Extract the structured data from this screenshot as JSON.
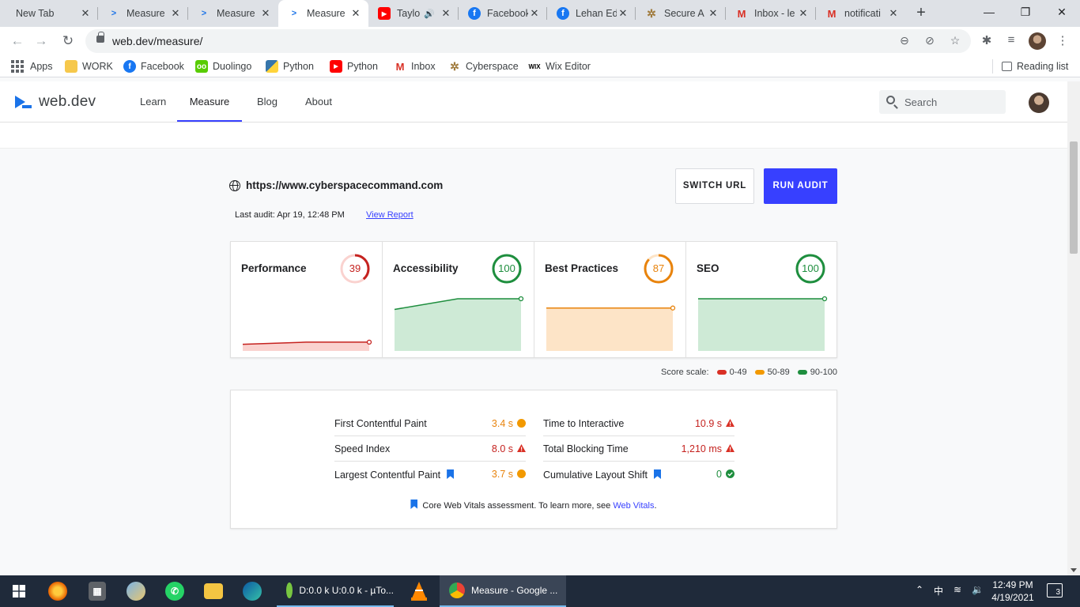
{
  "browser": {
    "tabs": [
      {
        "title": "New Tab",
        "icon": "none"
      },
      {
        "title": "Measure",
        "icon": "webdev-icon"
      },
      {
        "title": "Measure",
        "icon": "webdev-icon"
      },
      {
        "title": "Measure",
        "icon": "webdev-icon",
        "active": true
      },
      {
        "title": "Taylo",
        "icon": "youtube-icon",
        "audio": true
      },
      {
        "title": "Facebook",
        "icon": "facebook-icon"
      },
      {
        "title": "Lehan Ed",
        "icon": "facebook-icon"
      },
      {
        "title": "Secure A",
        "icon": "cyberspace-icon"
      },
      {
        "title": "Inbox - le",
        "icon": "gmail-icon"
      },
      {
        "title": "notificati",
        "icon": "gmail-icon"
      }
    ],
    "url": "web.dev/measure/",
    "bookmarks": [
      {
        "label": "Apps",
        "icon": "apps-grid-icon"
      },
      {
        "label": "WORK",
        "icon": "folder-icon"
      },
      {
        "label": "Facebook",
        "icon": "facebook-icon"
      },
      {
        "label": "Duolingo",
        "icon": "duolingo-icon"
      },
      {
        "label": "Python",
        "icon": "python-icon"
      },
      {
        "label": "Python",
        "icon": "youtube-icon"
      },
      {
        "label": "Inbox",
        "icon": "gmail-icon"
      },
      {
        "label": "Cyberspace",
        "icon": "cyberspace-icon"
      },
      {
        "label": "Wix Editor",
        "icon": "wix-icon"
      }
    ],
    "reading_list": "Reading list"
  },
  "site": {
    "logo": "web.dev",
    "nav": [
      "Learn",
      "Measure",
      "Blog",
      "About"
    ],
    "active_nav": "Measure",
    "search_placeholder": "Search"
  },
  "audit": {
    "url": "https://www.cyberspacecommand.com",
    "last_audit": "Last audit: Apr 19, 12:48 PM",
    "view_report": "View Report",
    "switch_url": "SWITCH URL",
    "run_audit": "RUN AUDIT"
  },
  "scores": [
    {
      "label": "Performance",
      "score": "39",
      "value": 39,
      "color": "#c5221f",
      "fill": "#fad2cf",
      "history": [
        36,
        39,
        39
      ]
    },
    {
      "label": "Accessibility",
      "score": "100",
      "value": 100,
      "color": "#1e8e3e",
      "fill": "#ceead6",
      "history": [
        85,
        100,
        100
      ]
    },
    {
      "label": "Best Practices",
      "score": "87",
      "value": 87,
      "color": "#e8830c",
      "fill": "#fde4c7",
      "history": [
        87,
        87,
        87
      ]
    },
    {
      "label": "SEO",
      "score": "100",
      "value": 100,
      "color": "#1e8e3e",
      "fill": "#ceead6",
      "history": [
        100,
        100,
        100
      ]
    }
  ],
  "score_scale": {
    "label": "Score scale:",
    "ranges": [
      {
        "label": "0-49",
        "color": "#d93025"
      },
      {
        "label": "50-89",
        "color": "#f29900"
      },
      {
        "label": "90-100",
        "color": "#1e8e3e"
      }
    ]
  },
  "metrics": [
    {
      "label": "First Contentful Paint",
      "value": "3.4 s",
      "status": "average",
      "cwv": false
    },
    {
      "label": "Speed Index",
      "value": "8.0 s",
      "status": "fail",
      "cwv": false
    },
    {
      "label": "Largest Contentful Paint",
      "value": "3.7 s",
      "status": "average",
      "cwv": true
    },
    {
      "label": "Time to Interactive",
      "value": "10.9 s",
      "status": "fail",
      "cwv": false
    },
    {
      "label": "Total Blocking Time",
      "value": "1,210 ms",
      "status": "fail",
      "cwv": false
    },
    {
      "label": "Cumulative Layout Shift",
      "value": "0",
      "status": "pass",
      "cwv": true
    }
  ],
  "cwv_note": {
    "text": "Core Web Vitals assessment. To learn more, see ",
    "link": "Web Vitals",
    "suffix": "."
  },
  "taskbar": {
    "tasks": [
      {
        "label": "D:0.0 k U:0.0 k - µTo...",
        "icon": "utorrent-icon"
      },
      {
        "label": "Measure - Google ...",
        "icon": "chrome-icon"
      }
    ],
    "time": "12:49 PM",
    "date": "4/19/2021",
    "ime": "中",
    "notifications": "3"
  }
}
